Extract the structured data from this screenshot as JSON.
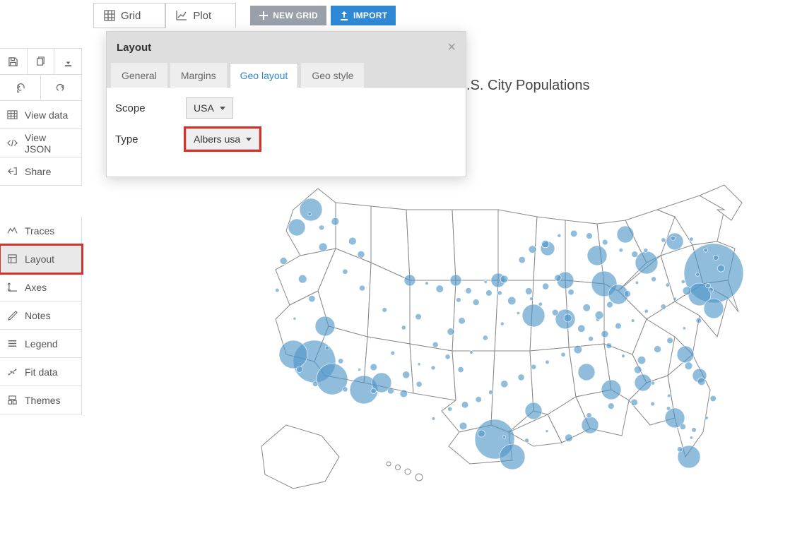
{
  "top": {
    "tabs": {
      "grid": "Grid",
      "plot": "Plot"
    },
    "buttons": {
      "newgrid": "NEW GRID",
      "import": "IMPORT"
    }
  },
  "sidebar": {
    "items": {
      "viewdata": "View data",
      "viewjson": "View JSON",
      "share": "Share",
      "traces": "Traces",
      "layout": "Layout",
      "axes": "Axes",
      "notes": "Notes",
      "legend": "Legend",
      "fitdata": "Fit data",
      "themes": "Themes"
    }
  },
  "chart": {
    "title_suffix": ".S. City Populations"
  },
  "panel": {
    "title": "Layout",
    "tabs": {
      "general": "General",
      "margins": "Margins",
      "geolayout": "Geo layout",
      "geostyle": "Geo style"
    },
    "scope_label": "Scope",
    "scope_value": "USA",
    "type_label": "Type",
    "type_value": "Albers usa"
  }
}
